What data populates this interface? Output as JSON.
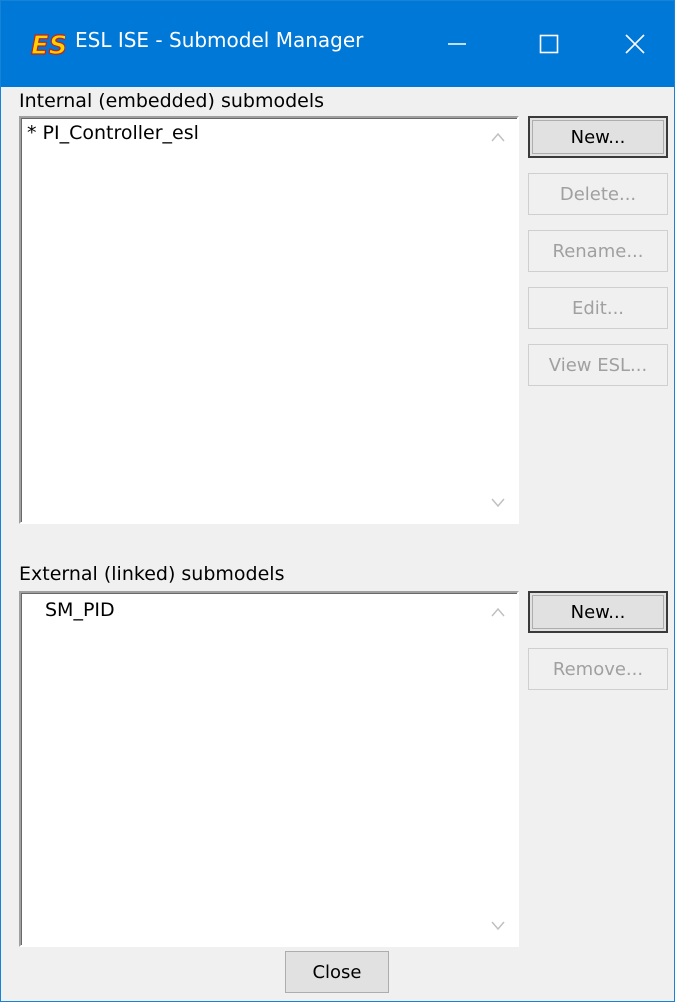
{
  "window": {
    "title": "ESL ISE - Submodel Manager",
    "accent_color": "#0078d7",
    "controls": {
      "minimize_icon": "minimize-icon",
      "maximize_icon": "maximize-icon",
      "close_icon": "close-icon"
    }
  },
  "internal": {
    "label": "Internal (embedded) submodels",
    "items": [
      "* PI_Controller_esl"
    ],
    "buttons": {
      "new": "New...",
      "delete": "Delete...",
      "rename": "Rename...",
      "edit": "Edit...",
      "view_esl": "View ESL..."
    }
  },
  "external": {
    "label": "External (linked) submodels",
    "items": [
      "SM_PID"
    ],
    "buttons": {
      "new": "New...",
      "remove": "Remove..."
    }
  },
  "footer": {
    "close": "Close"
  }
}
